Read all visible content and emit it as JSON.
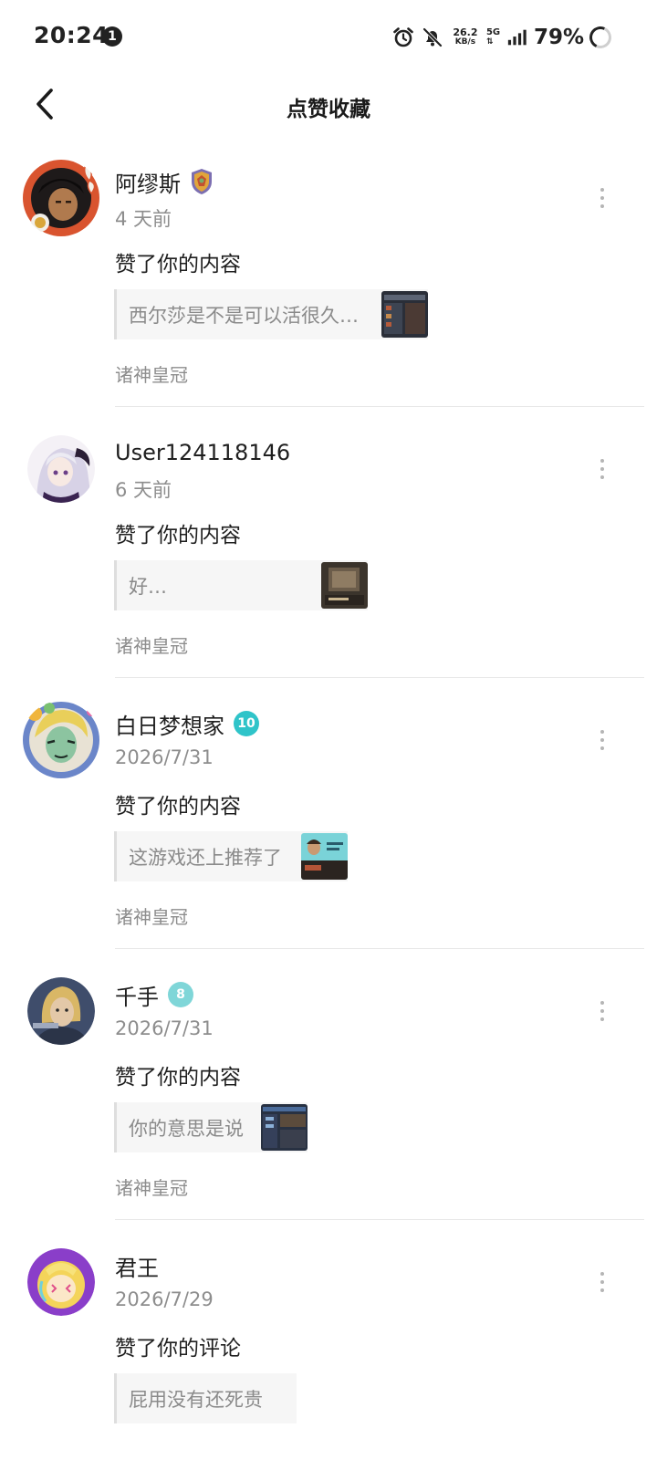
{
  "status_bar": {
    "time": "20:24",
    "notification_count": "1",
    "net_speed_value": "26.2",
    "net_speed_unit": "KB/s",
    "network_type": "5G",
    "battery": "79%",
    "icons": [
      "alarm-icon",
      "mute-bell-icon",
      "signal-icon",
      "battery-ring-icon"
    ]
  },
  "header": {
    "title": "点赞收藏",
    "back_icon": "chevron-left-icon"
  },
  "items": [
    {
      "username": "阿缪斯",
      "badge": "shield-badge",
      "time": "4 天前",
      "action": "赞了你的内容",
      "quote": "西尔莎是不是可以活很久…",
      "source": "诸神皇冠",
      "avatar_color": "#d9542f"
    },
    {
      "username": "User124118146",
      "badge": "",
      "time": "6 天前",
      "action": "赞了你的内容",
      "quote": "好…",
      "source": "诸神皇冠",
      "avatar_color": "#8e7db8"
    },
    {
      "username": "白日梦想家",
      "badge": "10",
      "time": "2026/7/31",
      "action": "赞了你的内容",
      "quote": "这游戏还上推荐了",
      "source": "诸神皇冠",
      "avatar_color": "#6b86c9"
    },
    {
      "username": "千手",
      "badge": "8",
      "time": "2026/7/31",
      "action": "赞了你的内容",
      "quote": "你的意思是说",
      "source": "诸神皇冠",
      "avatar_color": "#3f4d6b"
    },
    {
      "username": "君王",
      "badge": "",
      "time": "2026/7/29",
      "action": "赞了你的评论",
      "quote": "屁用没有还死贵",
      "source": "",
      "avatar_color": "#8a3ec9"
    }
  ],
  "colors": {
    "level_10": "#2fc4c9",
    "level_8": "#7fd6d8",
    "divider": "#e8e8e8",
    "muted_text": "#8d8d8d"
  }
}
